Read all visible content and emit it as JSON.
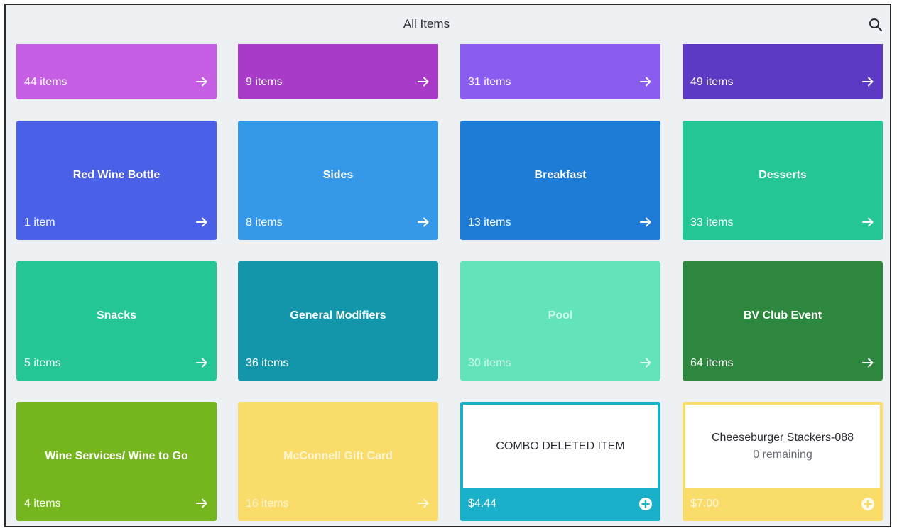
{
  "header": {
    "title": "All Items",
    "search_icon": "search-icon"
  },
  "categories": [
    {
      "name": "",
      "count": "44 items",
      "color": "#c65fe3"
    },
    {
      "name": "",
      "count": "9 items",
      "color": "#a83cc9"
    },
    {
      "name": "",
      "count": "31 items",
      "color": "#8b5cf0"
    },
    {
      "name": "",
      "count": "49 items",
      "color": "#5d3ac3"
    },
    {
      "name": "Red Wine Bottle",
      "count": "1 item",
      "color": "#4a60e6"
    },
    {
      "name": "Sides",
      "count": "8 items",
      "color": "#3598e8"
    },
    {
      "name": "Breakfast",
      "count": "13 items",
      "color": "#1e7bd6"
    },
    {
      "name": "Desserts",
      "count": "33 items",
      "color": "#23c694"
    },
    {
      "name": "Snacks",
      "count": "5 items",
      "color": "#23c694"
    },
    {
      "name": "General Modifiers",
      "count": "36 items",
      "color": "#1396a9"
    },
    {
      "name": "Pool",
      "count": "30 items",
      "color": "#63e3bb"
    },
    {
      "name": "BV Club Event",
      "count": "64 items",
      "color": "#2e873f"
    },
    {
      "name": "Wine Services/ Wine to Go",
      "count": "4 items",
      "color": "#75b51d"
    },
    {
      "name": "McConnell Gift Card",
      "count": "16 items",
      "color": "#fadc6b"
    }
  ],
  "items": [
    {
      "name": "COMBO DELETED ITEM",
      "sub": "",
      "price": "$4.44",
      "color": "#1ab0c9"
    },
    {
      "name": "Cheeseburger Stackers-088",
      "sub": "0 remaining",
      "price": "$7.00",
      "color": "#fadc6b"
    }
  ]
}
